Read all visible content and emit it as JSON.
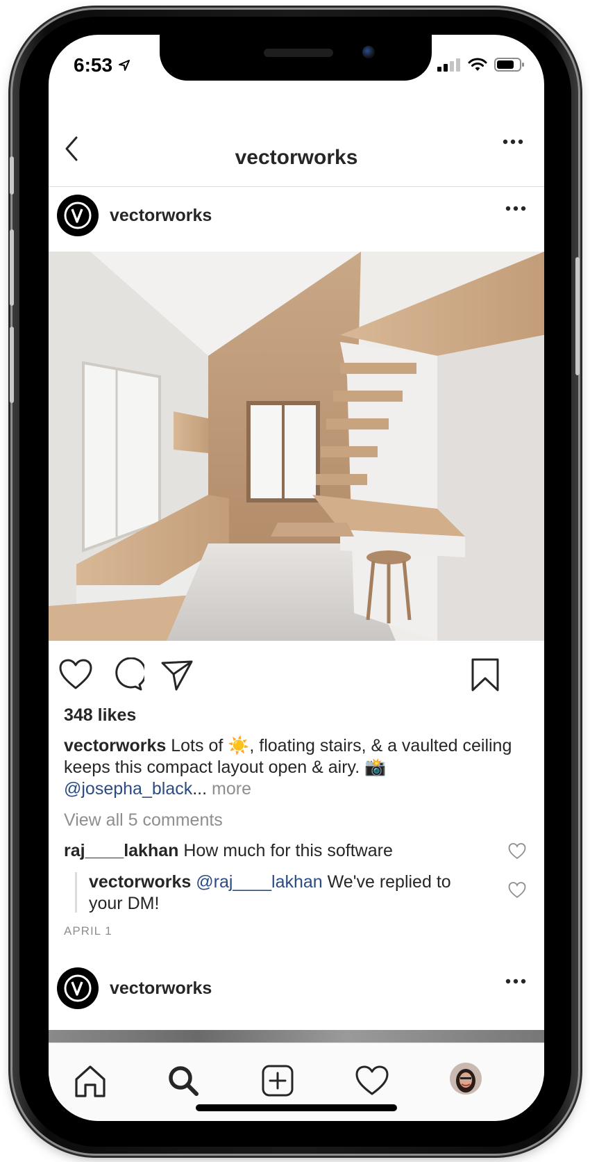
{
  "status_bar": {
    "time": "6:53"
  },
  "nav": {
    "title": "vectorworks"
  },
  "post": {
    "username": "vectorworks",
    "likes": "348 likes",
    "caption_user": "vectorworks",
    "caption_part1": " Lots of ",
    "caption_emoji_sun": "☀️",
    "caption_part2": ", floating stairs, & a vaulted ceiling keeps this compact layout open & airy. ",
    "caption_emoji_camera": "📸",
    "caption_mention": "@josepha_black",
    "caption_ellipsis": "...",
    "caption_more": " more",
    "view_all": "View all 5 comments",
    "comments": [
      {
        "user": "raj____lakhan",
        "text": " How much for this software"
      }
    ],
    "reply": {
      "user": "vectorworks",
      "mention": " @raj____lakhan",
      "text": " We've replied to your DM!"
    },
    "date": "APRIL 1"
  },
  "next_post": {
    "username": "vectorworks"
  },
  "tabbar": {
    "items": [
      "home",
      "search",
      "new-post",
      "activity",
      "profile"
    ]
  },
  "colors": {
    "mention": "#2a4b83",
    "muted": "#8e8e8e",
    "text": "#262626"
  }
}
